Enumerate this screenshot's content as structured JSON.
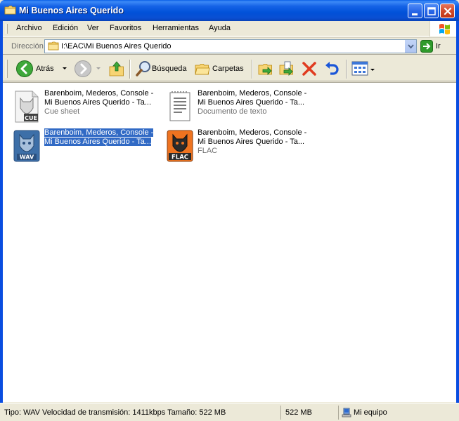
{
  "window": {
    "title": "Mi Buenos Aires Querido"
  },
  "menu": {
    "items": [
      "Archivo",
      "Edición",
      "Ver",
      "Favoritos",
      "Herramientas",
      "Ayuda"
    ]
  },
  "address": {
    "label": "Dirección",
    "value": "I:\\EAC\\Mi Buenos Aires Querido",
    "go_label": "Ir"
  },
  "toolbar": {
    "back_label": "Atrás",
    "search_label": "Búsqueda",
    "folders_label": "Carpetas"
  },
  "files": [
    {
      "name": "Barenboim, Mederos, Console -\nMi Buenos Aires Querido - Ta...",
      "type": "Cue sheet",
      "icon": "cue-file-icon"
    },
    {
      "name": "Barenboim, Mederos, Console -\nMi Buenos Aires Querido - Ta...",
      "type": "Documento de texto",
      "icon": "text-document-icon"
    },
    {
      "name": "Barenboim, Mederos, Console -\nMi Buenos Aires Querido - Ta...",
      "type": "",
      "icon": "wav-file-icon",
      "selected": true
    },
    {
      "name": "Barenboim, Mederos, Console -\nMi Buenos Aires Querido - Ta...",
      "type": "FLAC",
      "icon": "flac-file-icon"
    }
  ],
  "status": {
    "info": "Tipo: WAV Velocidad de transmisión: 1411kbps Tamaño: 522 MB",
    "size": "522 MB",
    "location": "Mi equipo"
  },
  "colors": {
    "title_bar": "#0a4fd3",
    "selection": "#316ac5",
    "window_face": "#ece9d8"
  }
}
